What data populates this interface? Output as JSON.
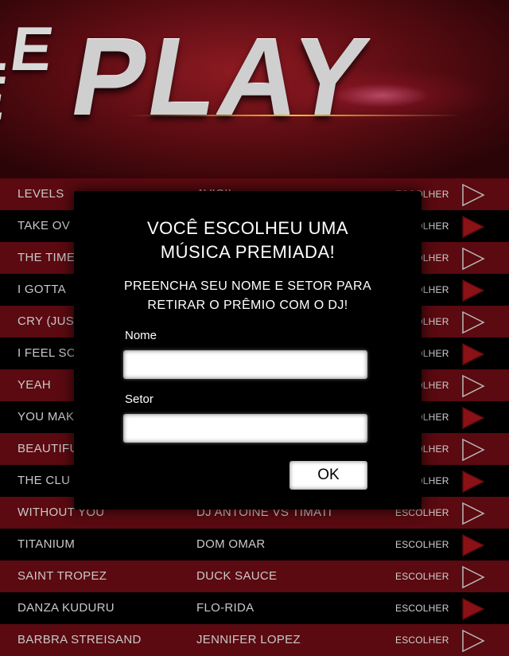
{
  "banner": {
    "lead_line1": "LE",
    "lead_line2": "E",
    "title": "PLAY"
  },
  "songs": [
    {
      "title": "LEVELS",
      "artist": "AVICII",
      "action": "ESCOLHER"
    },
    {
      "title": "TAKE OV",
      "artist": "",
      "action": "ESCOLHER"
    },
    {
      "title": "THE TIME",
      "artist": "",
      "action": "ESCOLHER"
    },
    {
      "title": "I GOTTA",
      "artist": "",
      "action": "ESCOLHER"
    },
    {
      "title": "CRY (JUS",
      "artist": "",
      "action": "ESCOLHER"
    },
    {
      "title": "I FEEL SO",
      "artist": "",
      "action": "ESCOLHER"
    },
    {
      "title": "YEAH",
      "artist": "",
      "action": "ESCOLHER"
    },
    {
      "title": "YOU MAK",
      "artist": "",
      "action": "ESCOLHER"
    },
    {
      "title": "BEAUTIFU",
      "artist": "",
      "action": "ESCOLHER"
    },
    {
      "title": "THE CLU",
      "artist": "",
      "action": "ESCOLHER"
    },
    {
      "title": "WITHOUT YOU",
      "artist": "DJ ANTOINE VS TIMATI",
      "action": "ESCOLHER"
    },
    {
      "title": "TITANIUM",
      "artist": "DOM OMAR",
      "action": "ESCOLHER"
    },
    {
      "title": "SAINT TROPEZ",
      "artist": "DUCK SAUCE",
      "action": "ESCOLHER"
    },
    {
      "title": "DANZA KUDURU",
      "artist": "FLO-RIDA",
      "action": "ESCOLHER"
    },
    {
      "title": "BARBRA STREISAND",
      "artist": "JENNIFER LOPEZ",
      "action": "ESCOLHER"
    }
  ],
  "modal": {
    "heading_line1": "VOCÊ ESCOLHEU UMA",
    "heading_line2": "MÚSICA PREMIADA!",
    "sub_line1": "PREENCHA SEU NOME E SETOR PARA",
    "sub_line2": "RETIRAR O PRÊMIO COM O DJ!",
    "name_label": "Nome",
    "name_value": "",
    "sector_label": "Setor",
    "sector_value": "",
    "ok_label": "OK"
  },
  "colors": {
    "row_red": "#5a0a10",
    "row_black": "#000000",
    "arrow_red": "#8a1216",
    "text": "#c9c9c9"
  },
  "icons": {
    "row_action": "play-arrow-icon"
  }
}
